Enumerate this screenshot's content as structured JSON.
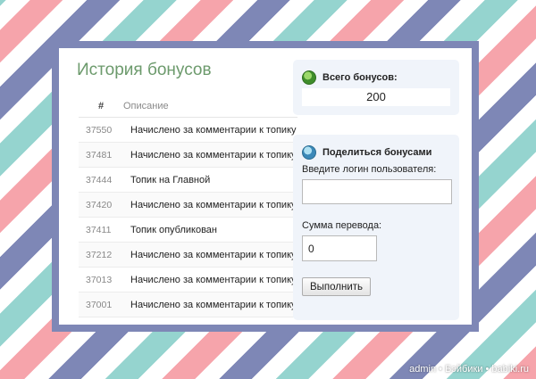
{
  "history": {
    "title": "История бонусов",
    "columns": {
      "id": "#",
      "description": "Описание"
    },
    "rows": [
      {
        "id": "37550",
        "description": "Начислено за комментарии к топику"
      },
      {
        "id": "37481",
        "description": "Начислено за комментарии к топику"
      },
      {
        "id": "37444",
        "description": "Топик на Главной"
      },
      {
        "id": "37420",
        "description": "Начислено за комментарии к топику"
      },
      {
        "id": "37411",
        "description": "Топик опубликован"
      },
      {
        "id": "37212",
        "description": "Начислено за комментарии к топику"
      },
      {
        "id": "37013",
        "description": "Начислено за комментарии к топику"
      },
      {
        "id": "37001",
        "description": "Начислено за комментарии к топику"
      }
    ]
  },
  "total": {
    "label": "Всего бонусов:",
    "value": "200",
    "icon": "globe-icon"
  },
  "share": {
    "title": "Поделиться бонусами",
    "icon": "share-globe-icon",
    "login_label": "Введите логин пользователя:",
    "login_value": "",
    "amount_label": "Сумма перевода:",
    "amount_value": "0",
    "submit_label": "Выполнить"
  },
  "watermark": "admin • Бэйбики • babiki.ru",
  "colors": {
    "title_green": "#6c9a6c",
    "frame": "#7e87b6",
    "box_bg": "#f0f4fa"
  }
}
